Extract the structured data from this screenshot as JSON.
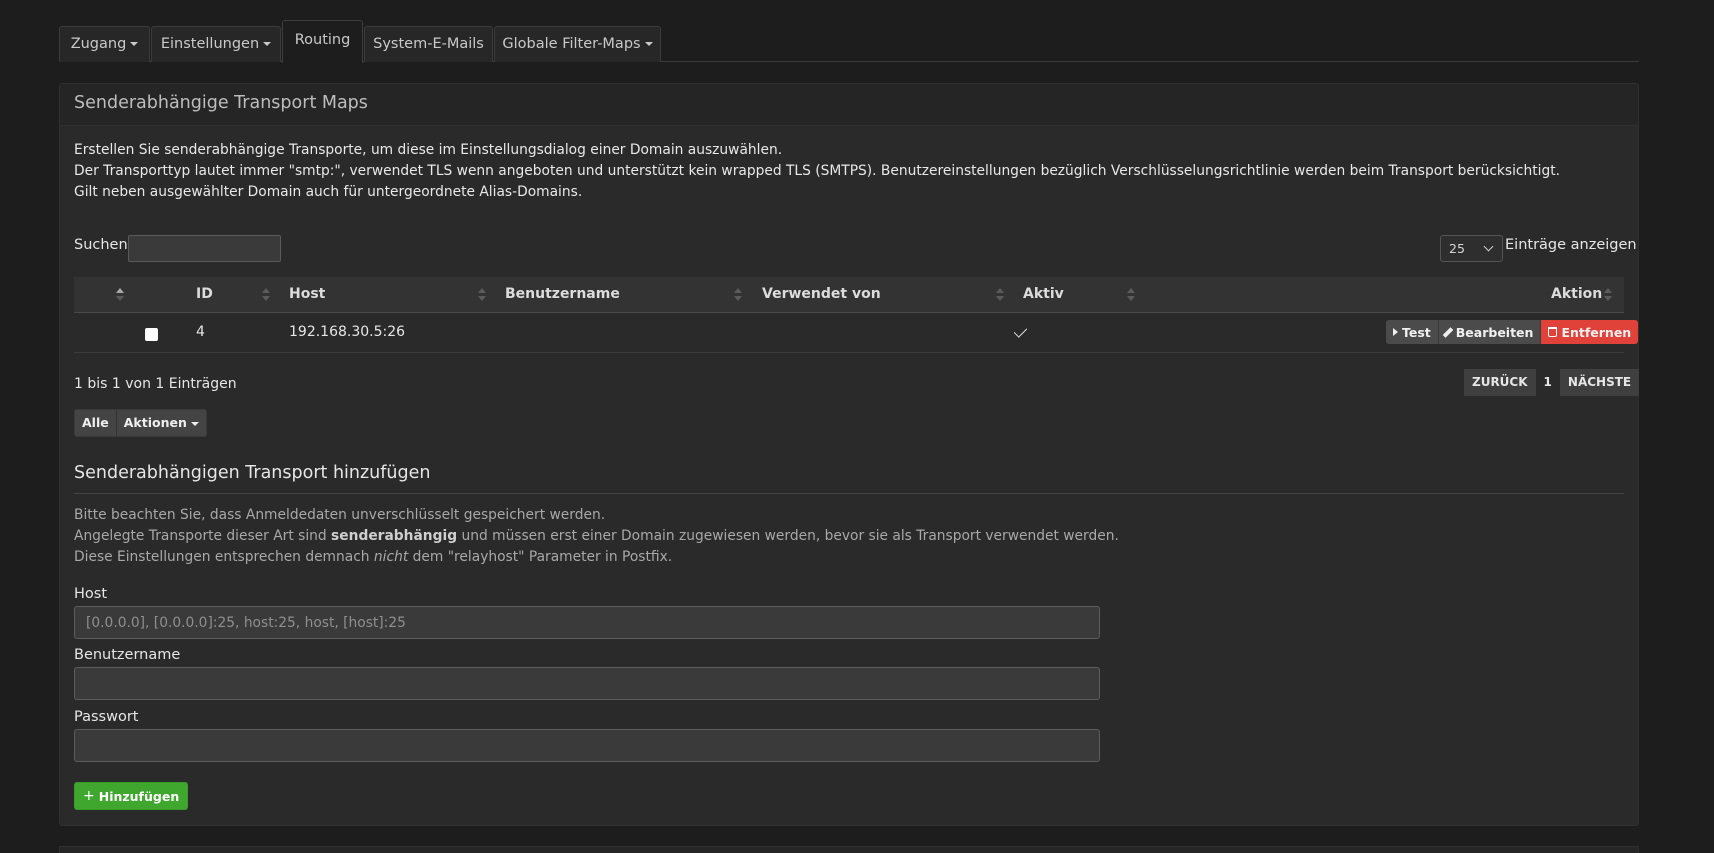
{
  "tabs": [
    {
      "label": "Zugang",
      "dropdown": true,
      "active": false
    },
    {
      "label": "Einstellungen",
      "dropdown": true,
      "active": false
    },
    {
      "label": "Routing",
      "dropdown": false,
      "active": true
    },
    {
      "label": "System-E-Mails",
      "dropdown": false,
      "active": false
    },
    {
      "label": "Globale Filter-Maps",
      "dropdown": true,
      "active": false
    }
  ],
  "panel": {
    "title": "Senderabhängige Transport Maps",
    "description": [
      "Erstellen Sie senderabhängige Transporte, um diese im Einstellungsdialog einer Domain auszuwählen.",
      "Der Transporttyp lautet immer \"smtp:\", verwendet TLS wenn angeboten und unterstützt kein wrapped TLS (SMTPS). Benutzereinstellungen bezüglich Verschlüsselungsrichtlinie werden beim Transport berücksichtigt.",
      "Gilt neben ausgewählter Domain auch für untergeordnete Alias-Domains."
    ]
  },
  "table": {
    "search_label": "Suchen",
    "search_value": "",
    "page_length": "25",
    "page_length_label": "Einträge anzeigen",
    "columns": [
      "",
      "ID",
      "Host",
      "Benutzername",
      "Verwendet von",
      "Aktiv",
      "Aktion"
    ],
    "rows": [
      {
        "id": "4",
        "host": "192.168.30.5:26",
        "username": "",
        "used_by": "",
        "active": true
      }
    ],
    "actions": {
      "test": "Test",
      "edit": "Bearbeiten",
      "remove": "Entfernen"
    },
    "info": "1 bis 1 von 1 Einträgen",
    "pager": {
      "prev": "ZURÜCK",
      "current": "1",
      "next": "NÄCHSTE"
    },
    "bulk": {
      "all": "Alle",
      "actions": "Aktionen"
    }
  },
  "add_form": {
    "title": "Senderabhängigen Transport hinzufügen",
    "note_line1": "Bitte beachten Sie, dass Anmeldedaten unverschlüsselt gespeichert werden.",
    "note_line2_pre": "Angelegte Transporte dieser Art sind ",
    "note_line2_bold": "senderabhängig",
    "note_line2_post": " und müssen erst einer Domain zugewiesen werden, bevor sie als Transport verwendet werden.",
    "note_line3_pre": "Diese Einstellungen entsprechen demnach ",
    "note_line3_italic": "nicht",
    "note_line3_post": " dem \"relayhost\" Parameter in Postfix.",
    "host_label": "Host",
    "host_placeholder": "[0.0.0.0], [0.0.0.0]:25, host:25, host, [host]:25",
    "username_label": "Benutzername",
    "password_label": "Passwort",
    "submit_label": "Hinzufügen"
  },
  "colors": {
    "accent_green": "#3fa62e",
    "danger_red": "#e0423a"
  }
}
